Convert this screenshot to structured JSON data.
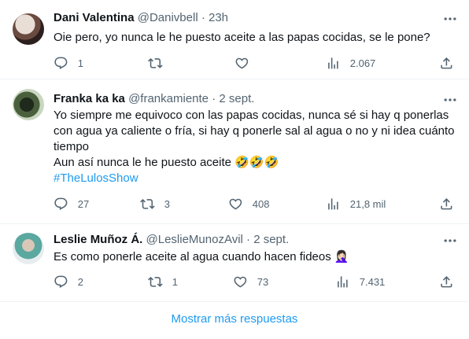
{
  "tweets": [
    {
      "name": "Dani Valentina",
      "handle": "@Danivbell",
      "separator": "·",
      "time": "23h",
      "text_lines": [
        "Oie pero, yo nunca le he puesto aceite a las papas cocidas, se le pone?"
      ],
      "hashtag": "",
      "emoji": "",
      "replies": "1",
      "retweets": "",
      "likes": "",
      "views": "2.067"
    },
    {
      "name": "Franka ka ka",
      "handle": "@frankamiente",
      "separator": "·",
      "time": "2 sept.",
      "text_lines": [
        "Yo siempre me equivoco con las papas cocidas, nunca sé si hay q ponerlas",
        "con agua ya caliente o fría, si hay q ponerle sal al agua o no y ni idea cuánto",
        "tiempo",
        "Aun así nunca le he puesto aceite 🤣🤣🤣"
      ],
      "hashtag": "#TheLulosShow",
      "emoji": "",
      "replies": "27",
      "retweets": "3",
      "likes": "408",
      "views": "21,8 mil"
    },
    {
      "name": "Leslie Muñoz Á.",
      "handle": "@LeslieMunozAvil",
      "separator": "·",
      "time": "2 sept.",
      "text_lines": [
        "Es como ponerle aceite al agua cuando hacen fideos 🤦🏻‍♀️"
      ],
      "hashtag": "",
      "emoji": "",
      "replies": "2",
      "retweets": "1",
      "likes": "73",
      "views": "7.431"
    }
  ],
  "footer": {
    "show_more": "Mostrar más respuestas"
  },
  "colors": {
    "accent": "#1d9bf0",
    "text": "#0f1419",
    "muted": "#536471",
    "divider": "#eff3f4"
  },
  "icons": [
    "reply-icon",
    "retweet-icon",
    "like-icon",
    "views-icon",
    "share-icon",
    "more-icon"
  ]
}
